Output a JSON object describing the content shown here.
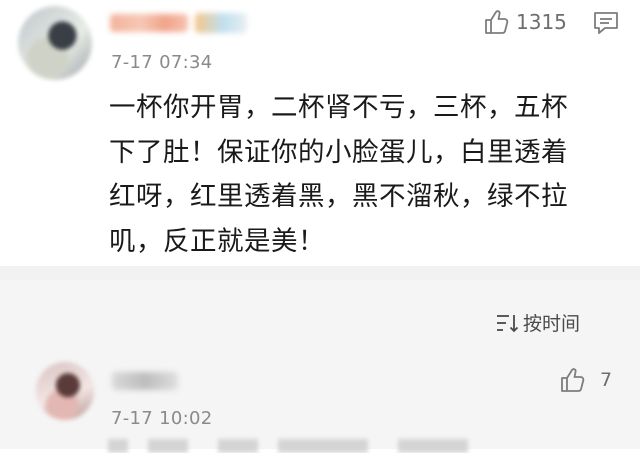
{
  "comment_main": {
    "timestamp": "7-17 07:34",
    "like_count": "1315",
    "text_lines": [
      "一杯你开胃，二杯肾不亏，三杯，五杯",
      "下了肚！保证你的小脸蛋儿，白里透着",
      "红呀，红里透着黑，黑不溜秋，绿不拉",
      "叽，反正就是美！"
    ]
  },
  "sort_bar": {
    "label": "按时间",
    "icon": "sort-lines-icon"
  },
  "comment_second": {
    "timestamp": "7-17 10:02",
    "like_count": "7"
  },
  "icons": {
    "like": "thumbs-up-icon",
    "reply": "comment-bubble-icon"
  },
  "colors": {
    "background": "#ffffff",
    "section_gray": "#f5f5f5",
    "muted_text": "#8a8a8a",
    "body_text": "#1a1a1a"
  }
}
